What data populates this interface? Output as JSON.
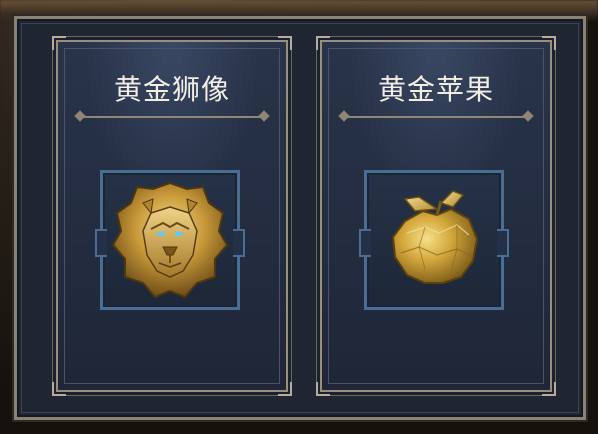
{
  "items": [
    {
      "title": "黄金狮像",
      "icon": "golden-lion-statue-icon"
    },
    {
      "title": "黄金苹果",
      "icon": "golden-apple-icon"
    }
  ],
  "colors": {
    "panel_bg": "#232c3f",
    "frame_border": "#9a8f7e",
    "icon_border": "#4a6e93",
    "title_text": "#f2eee6",
    "gold": "#c99a3a"
  }
}
